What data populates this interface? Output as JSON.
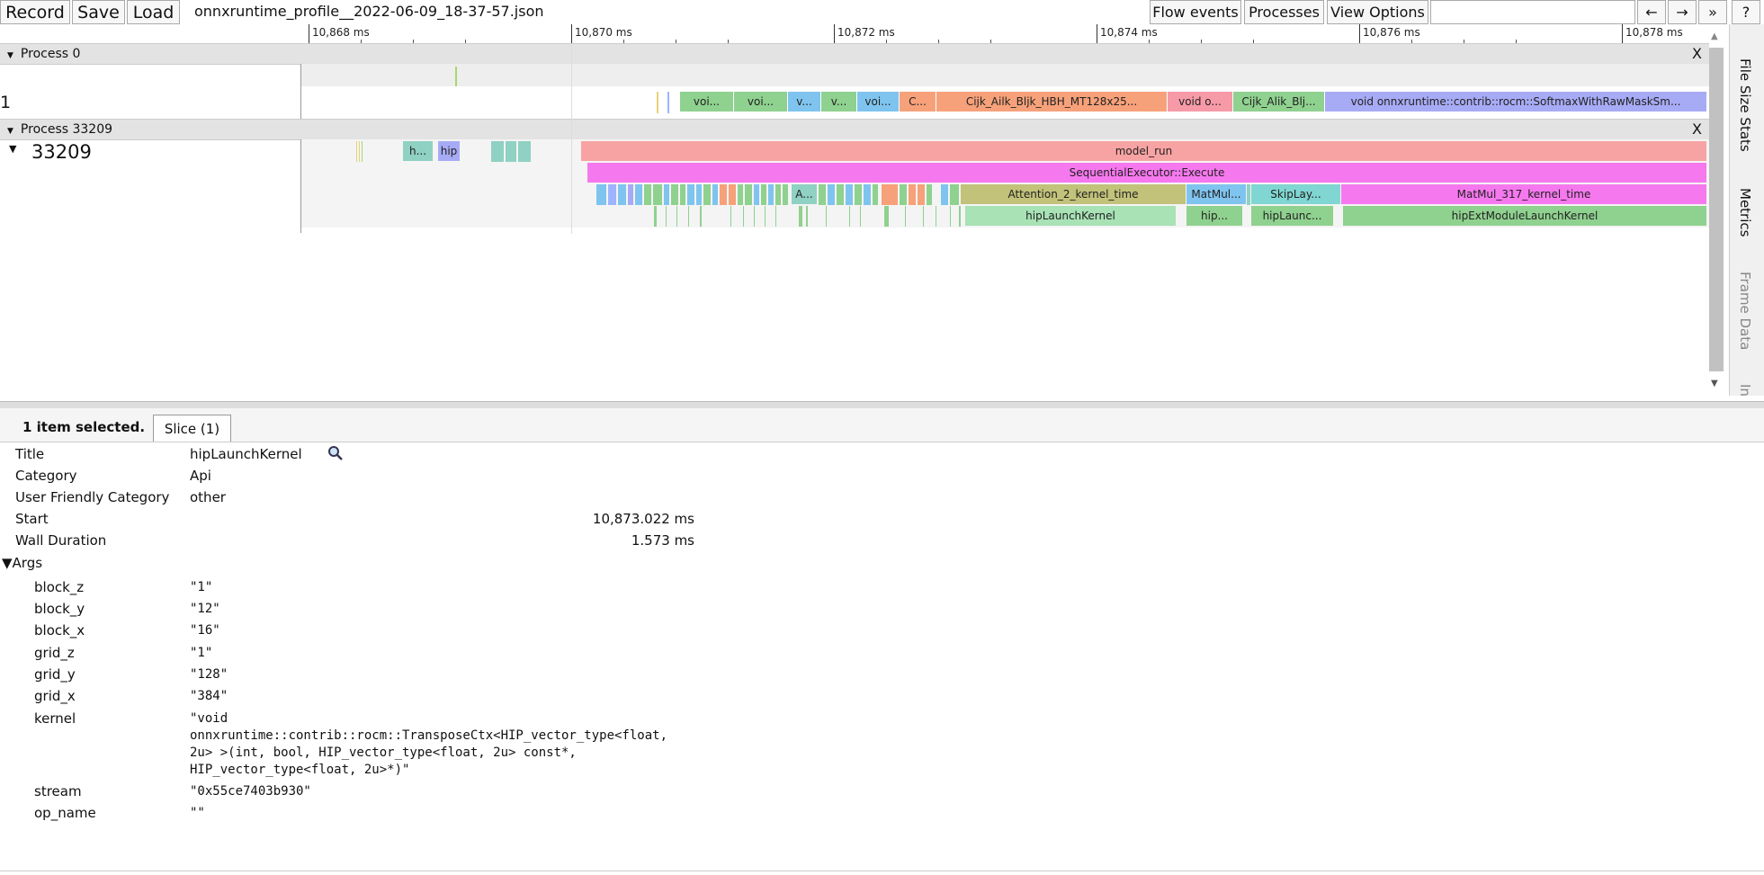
{
  "toolbar": {
    "record": "Record",
    "save": "Save",
    "load": "Load",
    "filename": "onnxruntime_profile__2022-06-09_18-37-57.json",
    "flow_events": "Flow events",
    "processes": "Processes",
    "view_options": "View Options",
    "back": "←",
    "forward": "→",
    "more": "»",
    "help": "?"
  },
  "ruler": {
    "labels": [
      "10,868 ms",
      "10,870 ms",
      "10,872 ms",
      "10,874 ms",
      "10,876 ms",
      "10,878 ms"
    ]
  },
  "process0": {
    "title": "Process 0",
    "close": "X",
    "thread_label": "1",
    "slices": [
      "voi...",
      "voi...",
      "v...",
      "v...",
      "voi...",
      "C...",
      "Cijk_Ailk_Bljk_HBH_MT128x25...",
      "void o...",
      "Cijk_Alik_Blj...",
      "void onnxruntime::contrib::rocm::SoftmaxWithRawMaskSm..."
    ]
  },
  "process1": {
    "title": "Process 33209",
    "close": "X",
    "thread_label": "33209",
    "early_slices": [
      "h...",
      "hip"
    ],
    "model_run": "model_run",
    "executor": "SequentialExecutor::Execute",
    "row3": [
      "A...",
      "Attention_2_kernel_time",
      "MatMul...",
      "SkipLay...",
      "MatMul_317_kernel_time"
    ],
    "row4": [
      "hipLaunchKernel",
      "hip...",
      "hipLaunc...",
      "hipExtModuleLaunchKernel"
    ]
  },
  "sidebar": {
    "tabs": [
      "File Size Stats",
      "Metrics",
      "Frame Data",
      "In"
    ]
  },
  "panel": {
    "selected": "1 item selected.",
    "tab": "Slice (1)",
    "fields": [
      {
        "label": "Title",
        "value": "hipLaunchKernel"
      },
      {
        "label": "Category",
        "value": "Api"
      },
      {
        "label": "User Friendly Category",
        "value": "other"
      },
      {
        "label": "Start",
        "value": "10,873.022 ms"
      },
      {
        "label": "Wall Duration",
        "value": "1.573 ms"
      }
    ],
    "args_label": "▼Args",
    "args": [
      {
        "key": "block_z",
        "value": "\"1\""
      },
      {
        "key": "block_y",
        "value": "\"12\""
      },
      {
        "key": "block_x",
        "value": "\"16\""
      },
      {
        "key": "grid_z",
        "value": "\"1\""
      },
      {
        "key": "grid_y",
        "value": "\"128\""
      },
      {
        "key": "grid_x",
        "value": "\"384\""
      },
      {
        "key": "kernel",
        "value_lines": [
          "\"void",
          "onnxruntime::contrib::rocm::TransposeCtx<HIP_vector_type<float,",
          "2u> >(int, bool, HIP_vector_type<float, 2u> const*,",
          "HIP_vector_type<float, 2u>*)\""
        ]
      },
      {
        "key": "stream",
        "value": "\"0x55ce7403b930\""
      },
      {
        "key": "op_name",
        "value": "\"\""
      }
    ]
  }
}
